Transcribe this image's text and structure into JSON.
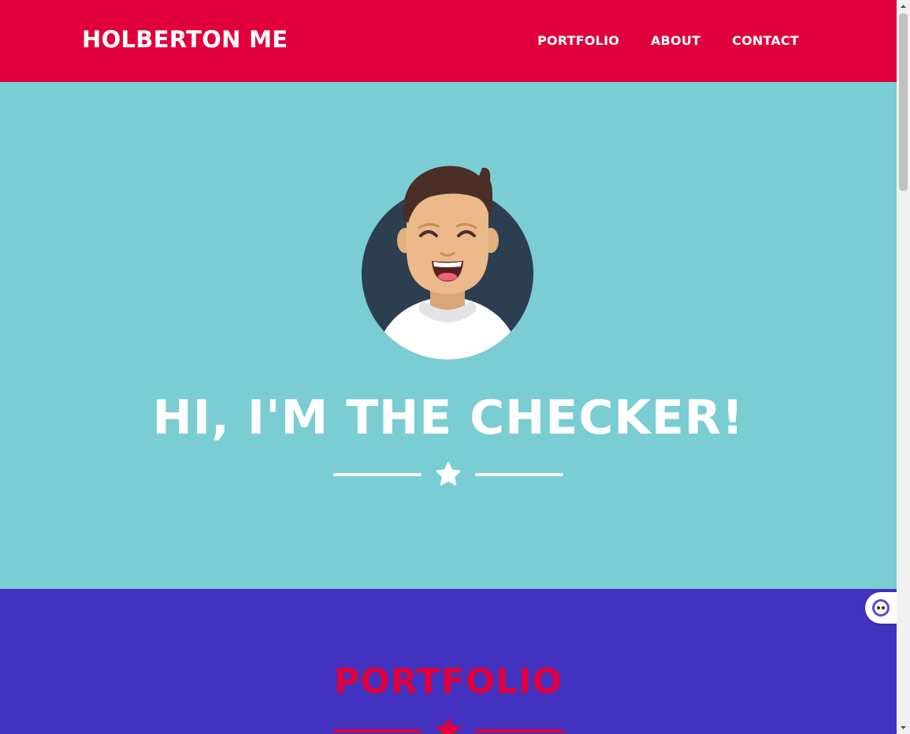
{
  "header": {
    "brand": "HOLBERTON ME",
    "nav": [
      {
        "label": "PORTFOLIO"
      },
      {
        "label": "ABOUT"
      },
      {
        "label": "CONTACT"
      }
    ]
  },
  "hero": {
    "title": "HI, I'M THE CHECKER!",
    "avatar_icon": "smiling-avatar-icon",
    "divider_icon": "star-icon"
  },
  "portfolio": {
    "title": "PORTFOLIO",
    "divider_icon": "star-icon"
  },
  "widget": {
    "icon": "assistant-face-icon"
  },
  "colors": {
    "header_bg": "#e0003b",
    "hero_bg": "#79cdd3",
    "portfolio_bg": "#4332bf",
    "accent": "#e0003b",
    "text_light": "#ffffff"
  }
}
